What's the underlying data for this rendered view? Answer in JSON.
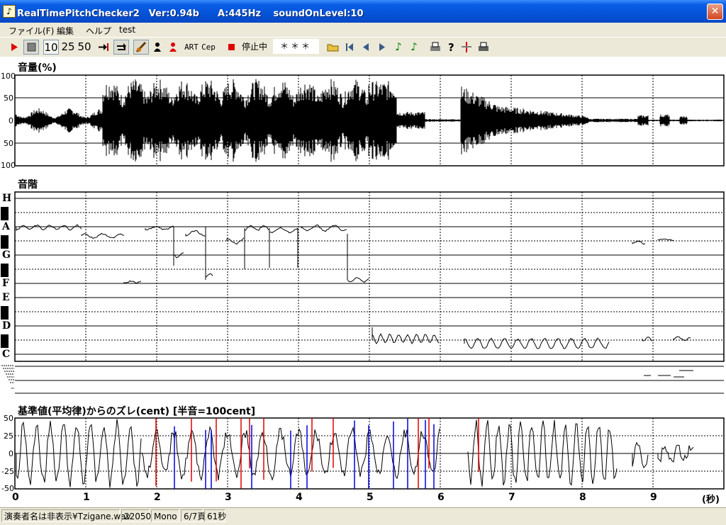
{
  "window": {
    "title": "RealTimePitchChecker2　Ver:0.94b　　A:445Hz　 soundOnLevel:10",
    "icon": "app-music-icon",
    "close_icon": "close-icon",
    "close_glyph": "✕"
  },
  "menu": [
    "ファイル(F)",
    "編集",
    "ヘルプ",
    "test"
  ],
  "toolbar": {
    "play_icon": "play-icon",
    "stop_icon": "stop-icon",
    "zoom_buttons": [
      "10",
      "25",
      "50"
    ],
    "art_label": "ART",
    "cep_label": "Cep",
    "stop_status_label": "停止中",
    "status_value": "＊＊＊"
  },
  "volume_panel": {
    "title": "音量(%)",
    "y_ticks": [
      "100",
      "50",
      "0",
      "50",
      "100"
    ]
  },
  "scale_panel": {
    "title": "音階",
    "notes": [
      "H",
      "A",
      "G",
      "F",
      "E",
      "D",
      "C"
    ]
  },
  "deviation_panel": {
    "title": "基準値(平均律)からのズレ(cent) [半音=100cent]",
    "y_ticks": [
      "50",
      "25",
      "0",
      "-25",
      "-50"
    ]
  },
  "x_axis": {
    "ticks": [
      "0",
      "1",
      "2",
      "3",
      "4",
      "5",
      "6",
      "7",
      "8",
      "9"
    ],
    "unit_label": "(秒)"
  },
  "statusbar": {
    "file": "演奏者名は非表示¥Tzigane.wav",
    "rate": "22050",
    "channels": "Mono",
    "page": "6/7頁",
    "duration": "61秒"
  },
  "colors": {
    "titlebar": "#0553d8",
    "grid": "#000000",
    "red_mark": "#e00000",
    "blue_mark": "#0000e0"
  }
}
